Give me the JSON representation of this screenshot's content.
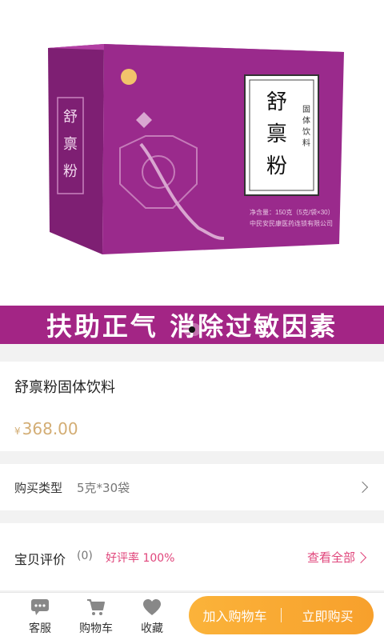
{
  "hero": {
    "box_brand": "舒禀粉",
    "box_side_label": "固体饮料",
    "box_side_brand": "舒禀粉",
    "box_weight": "净含量：150克（5克/袋×30）",
    "box_company": "中民安民康医药连锁有限公司",
    "banner": "扶助正气 消除过敏因素",
    "colors": {
      "purple": "#a32585",
      "box": "#9a2a8c"
    }
  },
  "product": {
    "title": "舒禀粉固体饮料",
    "currency": "¥",
    "price": "368.00"
  },
  "spec": {
    "label": "购买类型",
    "value": "5克*30袋"
  },
  "reviews": {
    "label": "宝贝评价",
    "count": "(0)",
    "rate": "好评率 100%",
    "view_all": "查看全部"
  },
  "tabbar": {
    "service": "客服",
    "cart": "购物车",
    "favorite": "收藏"
  },
  "actions": {
    "add_to_cart": "加入购物车",
    "buy_now": "立即购买"
  }
}
